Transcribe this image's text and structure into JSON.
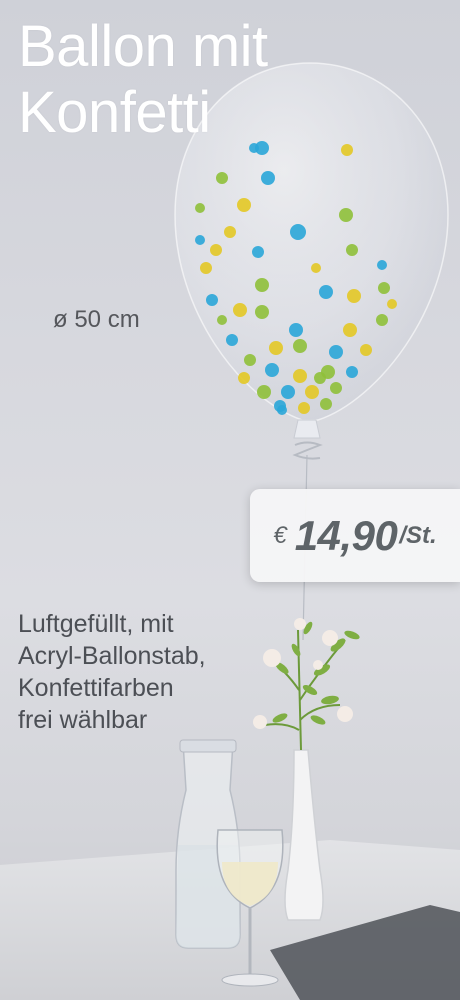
{
  "title": {
    "line1": "Ballon mit",
    "line2": "Konfetti"
  },
  "diameter": "ø 50 cm",
  "description": [
    "Luftgefüllt, mit",
    "Acryl-Ballonstab,",
    "Konfettifarben",
    "frei wählbar"
  ],
  "price": {
    "currency": "€",
    "amount": "14,90",
    "unit": "/St."
  },
  "colors": {
    "title": "#ffffff",
    "text": "#4c4f55",
    "price": "#5e6468",
    "confetti": [
      "#2aa6d8",
      "#e3c825",
      "#8fc03a"
    ]
  }
}
